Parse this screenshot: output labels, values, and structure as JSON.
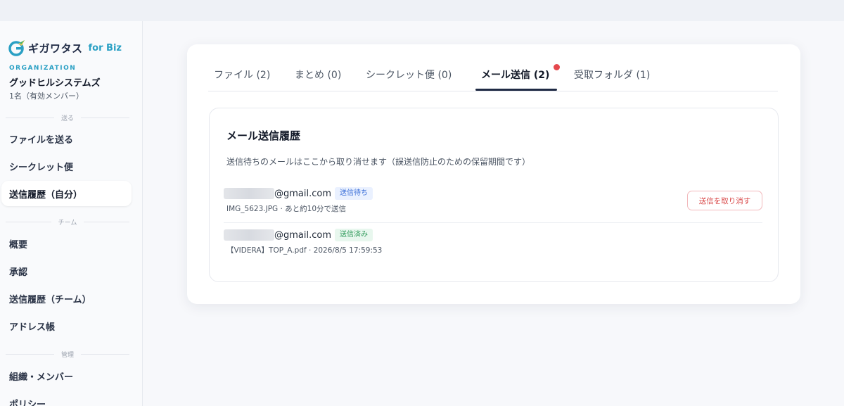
{
  "app": {
    "logo_text": "ギガワタス",
    "logo_suffix": "for Biz"
  },
  "organization": {
    "label": "ORGANIZATION",
    "name": "グッドヒルシステムズ",
    "members": "1名（有効メンバー）"
  },
  "sidebar": {
    "sections": [
      {
        "heading": "送る",
        "items": [
          {
            "label": "ファイルを送る",
            "active": false
          },
          {
            "label": "シークレット便",
            "active": false
          },
          {
            "label": "送信履歴（自分）",
            "active": true
          }
        ]
      },
      {
        "heading": "チーム",
        "items": [
          {
            "label": "概要",
            "active": false
          },
          {
            "label": "承認",
            "active": false
          },
          {
            "label": "送信履歴（チーム）",
            "active": false
          },
          {
            "label": "アドレス帳",
            "active": false
          }
        ]
      },
      {
        "heading": "管理",
        "items": [
          {
            "label": "組織・メンバー",
            "active": false
          },
          {
            "label": "ポリシー",
            "active": false
          }
        ]
      }
    ]
  },
  "tabs": [
    {
      "label": "ファイル (2)",
      "active": false
    },
    {
      "label": "まとめ (0)",
      "active": false
    },
    {
      "label": "シークレット便 (0)",
      "active": false
    },
    {
      "label": "メール送信 (2)",
      "active": true,
      "notification": true
    },
    {
      "label": "受取フォルダ (1)",
      "active": false
    }
  ],
  "panel": {
    "title": "メール送信履歴",
    "description": "送信待ちのメールはここから取り消せます（誤送信防止のための保留期間です）",
    "rows": [
      {
        "email": "@gmail.com",
        "status": "送信待ち",
        "details": "IMG_5623.JPG · あと約10分で送信",
        "action": "送信を取り消す"
      },
      {
        "email": "@gmail.com",
        "status": "送信済み",
        "details": "【VIDERA】TOP_A.pdf · 2026/8/5 17:59:53"
      }
    ]
  },
  "colors": {
    "accent": "#2aa0c4",
    "primary_text": "#1f2a44",
    "pending": "#3b6fd8",
    "sent": "#2f9a5a",
    "danger": "#d94848",
    "notification": "#e5484d"
  }
}
